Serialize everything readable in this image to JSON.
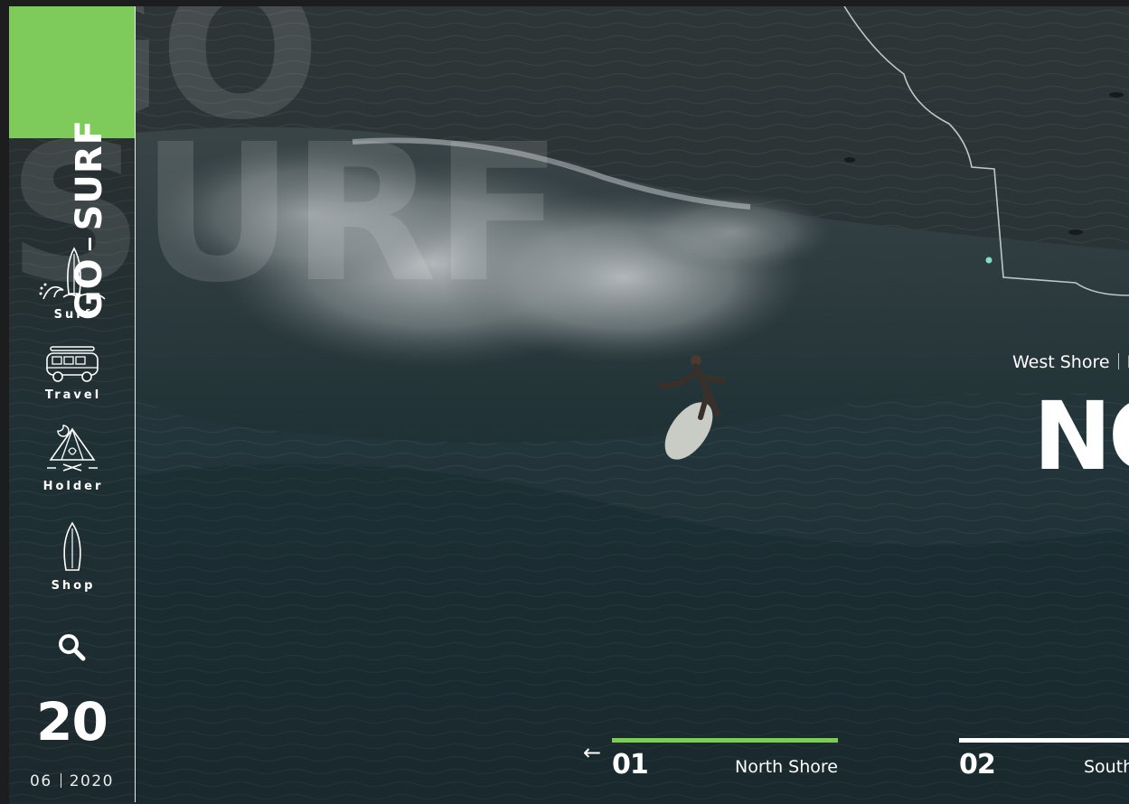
{
  "brand": {
    "logo_part1": "GO",
    "logo_part2": "SURF",
    "watermark_line1": "GO",
    "watermark_line2": "SURF",
    "accent_color": "#7ecb5c"
  },
  "sidebar": {
    "items": [
      {
        "label": "Surf",
        "icon": "surfboard-wave-icon"
      },
      {
        "label": "Travel",
        "icon": "van-icon"
      },
      {
        "label": "Holder",
        "icon": "tent-icon"
      },
      {
        "label": "Shop",
        "icon": "surfboard-icon"
      }
    ],
    "search_icon": "search-icon",
    "day": "20",
    "month": "06",
    "year": "2020"
  },
  "hero": {
    "location_1": "West Shore",
    "location_2": "M",
    "headline": "NO"
  },
  "slides": {
    "prev_arrow": "←",
    "items": [
      {
        "number": "01",
        "name": "North Shore",
        "active": true
      },
      {
        "number": "02",
        "name": "South",
        "active": false
      }
    ]
  }
}
